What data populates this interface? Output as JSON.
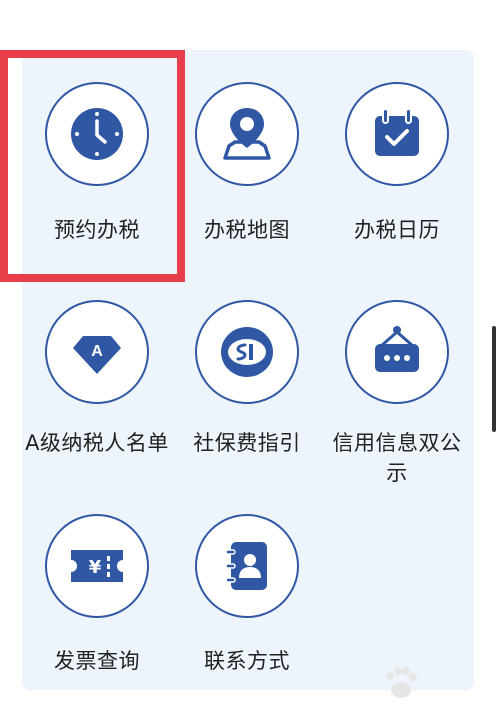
{
  "services": [
    {
      "label": "预约办税",
      "icon": "clock-icon"
    },
    {
      "label": "办税地图",
      "icon": "map-pin-icon"
    },
    {
      "label": "办税日历",
      "icon": "calendar-check-icon"
    },
    {
      "label": "A级纳税人名单",
      "icon": "diamond-a-icon"
    },
    {
      "label": "社保费指引",
      "icon": "social-security-icon"
    },
    {
      "label": "信用信息双公示",
      "icon": "sign-board-icon"
    },
    {
      "label": "发票查询",
      "icon": "invoice-ticket-icon"
    },
    {
      "label": "联系方式",
      "icon": "contact-book-icon"
    }
  ],
  "colors": {
    "accent": "#2f57a4",
    "panel": "#edf4fb",
    "highlight": "#e83e4a",
    "text": "#222222"
  }
}
